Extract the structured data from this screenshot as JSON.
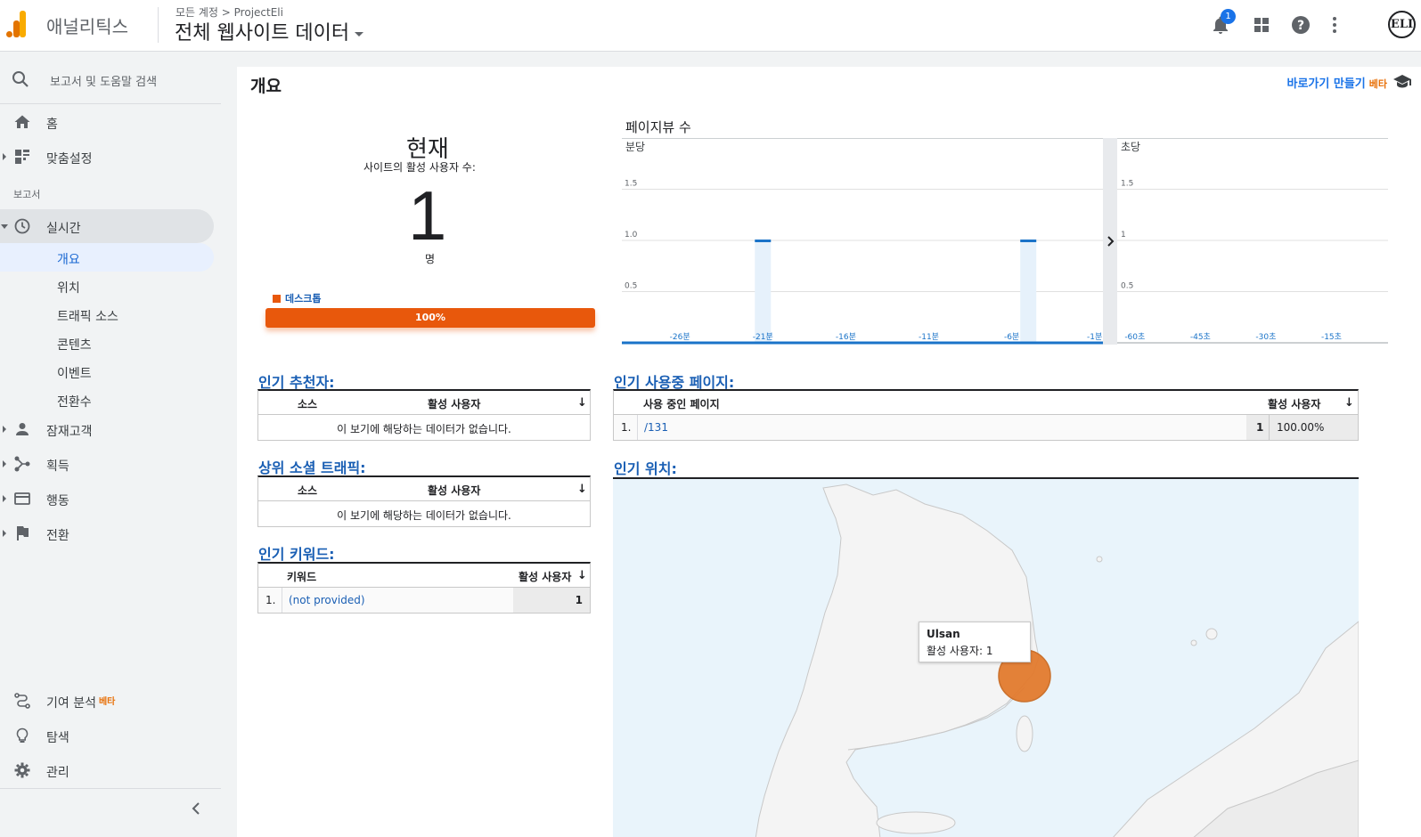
{
  "header": {
    "app_name": "애널리틱스",
    "breadcrumb": "모든 계정 > ProjectEli",
    "view_name": "전체 웹사이트 데이터",
    "notification_count": "1",
    "avatar_text": "ELI"
  },
  "sidebar": {
    "search_placeholder": "보고서 및 도움말 검색",
    "home": "홈",
    "customization": "맞춤설정",
    "reports_label": "보고서",
    "realtime": "실시간",
    "realtime_items": [
      "개요",
      "위치",
      "트래픽 소스",
      "콘텐츠",
      "이벤트",
      "전환수"
    ],
    "audience": "잠재고객",
    "acquisition": "획득",
    "behavior": "행동",
    "conversions": "전환",
    "attribution": "기여 분석",
    "attribution_badge": "베타",
    "discover": "탐색",
    "admin": "관리"
  },
  "main": {
    "title": "개요",
    "shortcut": "바로가기 만들기",
    "shortcut_badge": "베타",
    "now": {
      "title": "현재",
      "subtitle": "사이트의 활성 사용자 수:",
      "value": "1",
      "unit": "명",
      "device_label": "데스크톱",
      "device_percent": "100%",
      "device_fraction": 1.0
    },
    "pageviews_title": "페이지뷰 수",
    "top_referrals": {
      "title": "인기 추천자:",
      "col_source": "소스",
      "col_active": "활성 사용자",
      "empty": "이 보기에 해당하는 데이터가 없습니다."
    },
    "top_social": {
      "title": "상위 소셜 트래픽:",
      "col_source": "소스",
      "col_active": "활성 사용자",
      "empty": "이 보기에 해당하는 데이터가 없습니다."
    },
    "top_keywords": {
      "title": "인기 키워드:",
      "col_keyword": "키워드",
      "col_active": "활성 사용자",
      "rows": [
        {
          "rank": "1.",
          "keyword": "(not provided)",
          "value": "1"
        }
      ]
    },
    "top_pages": {
      "title": "인기 사용중 페이지:",
      "col_page": "사용 중인 페이지",
      "col_active": "활성 사용자",
      "rows": [
        {
          "rank": "1.",
          "page": "/131",
          "value": "1",
          "percent": "100.00%"
        }
      ]
    },
    "top_locations": {
      "title": "인기 위치:",
      "tooltip_city": "Ulsan",
      "tooltip_value": "활성 사용자: 1"
    }
  },
  "chart_data": [
    {
      "type": "bar",
      "title": "페이지뷰 수",
      "subtitle": "분당",
      "x_tick_labels": [
        "-26분",
        "-21분",
        "-16분",
        "-11분",
        "-6분",
        "-1분"
      ],
      "y_tick_labels": [
        "1.5",
        "1.0",
        "0.5"
      ],
      "ylim": [
        0,
        2
      ],
      "x": [
        -29,
        -28,
        -27,
        -26,
        -25,
        -24,
        -23,
        -22,
        -21,
        -20,
        -19,
        -18,
        -17,
        -16,
        -15,
        -14,
        -13,
        -12,
        -11,
        -10,
        -9,
        -8,
        -7,
        -6,
        -5,
        -4,
        -3,
        -2,
        -1
      ],
      "values": [
        0,
        0,
        0,
        0,
        0,
        0,
        0,
        0,
        1,
        0,
        0,
        0,
        0,
        0,
        0,
        0,
        0,
        0,
        0,
        0,
        0,
        0,
        0,
        0,
        1,
        0,
        0,
        0,
        0
      ],
      "color": "#1a73c8"
    },
    {
      "type": "bar",
      "subtitle": "초당",
      "x_tick_labels": [
        "-60초",
        "-45초",
        "-30초",
        "-15초"
      ],
      "y_tick_labels": [
        "1.5",
        "1",
        "0.5"
      ],
      "ylim": [
        0,
        2
      ],
      "values": []
    }
  ],
  "colors": {
    "accent": "#1a73e8",
    "desktop": "#e8580c",
    "map_bubble": "#e37b2e",
    "section_title": "#1a5fb4"
  }
}
